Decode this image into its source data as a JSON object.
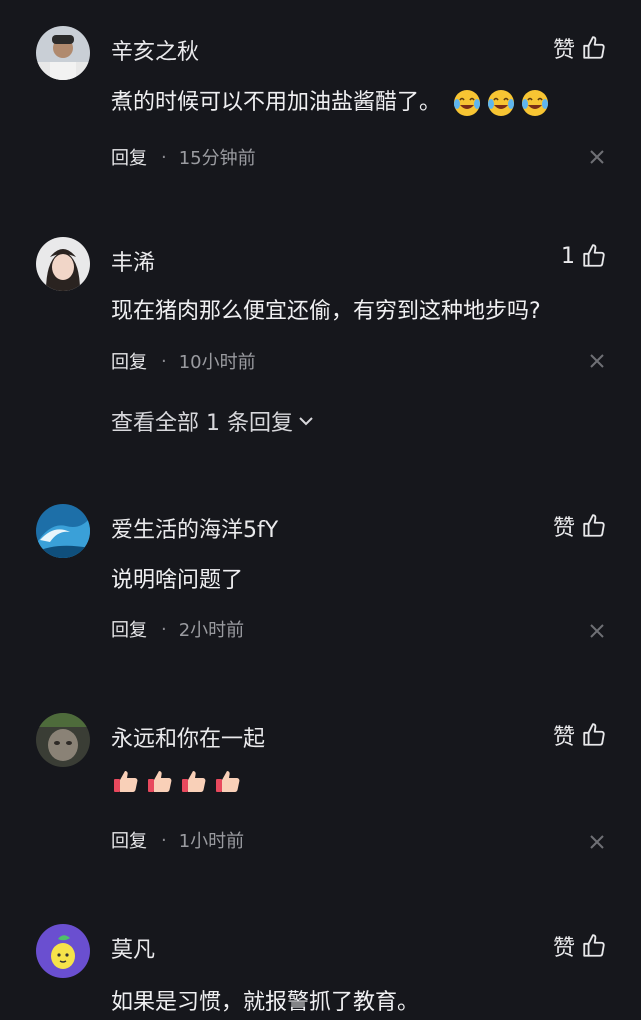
{
  "comments": [
    {
      "username": "辛亥之秋",
      "like_label": "赞",
      "content": "煮的时候可以不用加油盐酱醋了。",
      "emojis": [
        "laughing-crying",
        "laughing-crying",
        "laughing-crying"
      ],
      "reply_label": "回复",
      "dot": "·",
      "time": "15分钟前"
    },
    {
      "username": "丰浠",
      "like_label": "1",
      "content": "现在猪肉那么便宜还偷，有穷到这种地步吗?",
      "reply_label": "回复",
      "dot": "·",
      "time": "10小时前",
      "more_replies": "查看全部 1 条回复"
    },
    {
      "username": "爱生活的海洋5fY",
      "like_label": "赞",
      "content": "说明啥问题了",
      "reply_label": "回复",
      "dot": "·",
      "time": "2小时前"
    },
    {
      "username": "永远和你在一起",
      "like_label": "赞",
      "content": "",
      "emojis": [
        "thumbs-up",
        "thumbs-up",
        "thumbs-up",
        "thumbs-up"
      ],
      "reply_label": "回复",
      "dot": "·",
      "time": "1小时前"
    },
    {
      "username": "莫凡",
      "like_label": "赞",
      "content": "如果是习惯，就报警抓了教育。"
    }
  ]
}
